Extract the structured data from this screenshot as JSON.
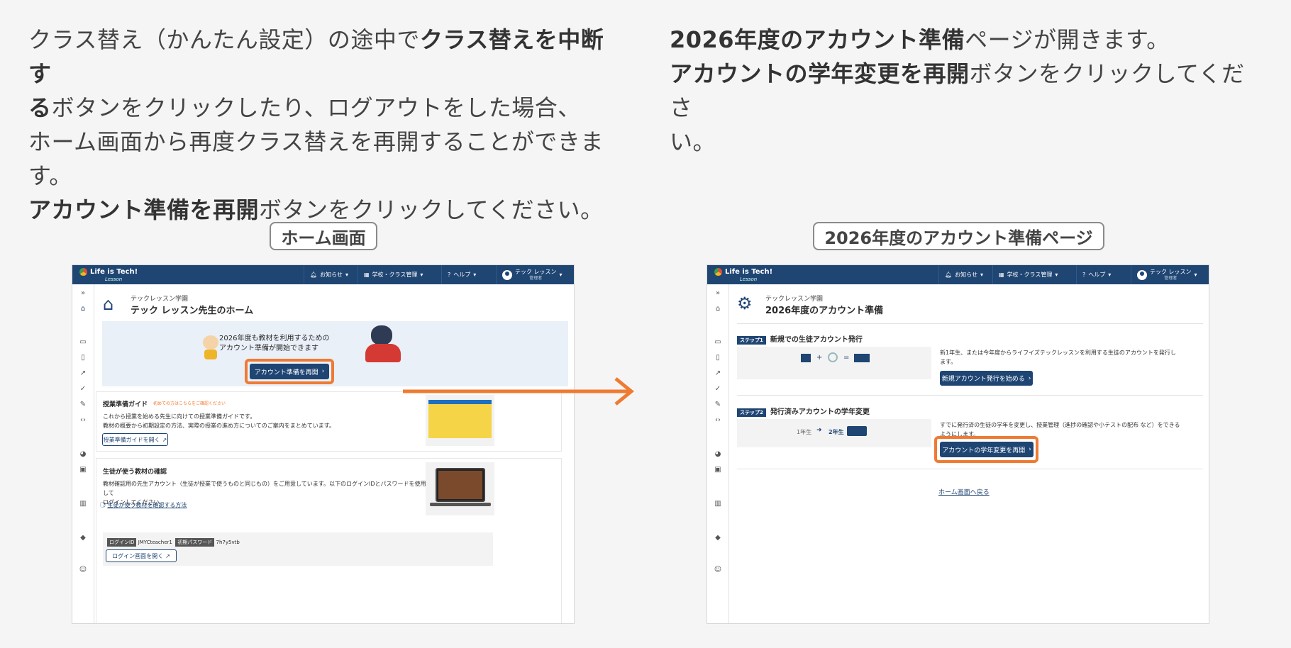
{
  "left_text": {
    "l1_a": "クラス替え（かんたん設定）の途中で",
    "l1_b": "クラス替えを中断す",
    "l2_a": "る",
    "l2_b": "ボタンをクリックしたり、ログアウトをした場合、",
    "l3": "ホーム画面から再度クラス替えを再開することができま",
    "l4": "す。",
    "l5_a": "アカウント準備を再開",
    "l5_b": "ボタンをクリックしてください。"
  },
  "right_text": {
    "l1_a": "2026年度のアカウント準備",
    "l1_b": "ページが開きます。",
    "l2_a": "アカウントの学年変更を再開",
    "l2_b": "ボタンをクリックしてくださ",
    "l3": "い。"
  },
  "captions": {
    "left": "ホーム画面",
    "right": "2026年度のアカウント準備ページ"
  },
  "topbar": {
    "logo": "Life is Tech!",
    "logo_sub": "Lesson",
    "news": "お知らせ",
    "school": "学校・クラス管理",
    "help": "ヘルプ",
    "user": "テック レッスン",
    "role": "管理者"
  },
  "home": {
    "school_name": "テックレッスン学園",
    "title": "テック レッスン先生のホーム",
    "banner_l1": "2026年度も教材を利用するための",
    "banner_l2": "アカウント準備が開始できます",
    "resume_button": "アカウント準備を再開",
    "guide_title": "授業準備ガイド",
    "guide_note": "初めての方はこちらをご確認ください",
    "guide_d1": "これから授業を始める先生に向けての授業準備ガイドです。",
    "guide_d2": "教材の概要から初期設定の方法、実際の授業の進め方についてのご案内をまとめています。",
    "guide_button": "授業準備ガイドを開く",
    "check_title": "生徒が使う教材の確認",
    "check_d1": "教材確認用の先生アカウント（生徒が授業で使うものと同じもの）をご用意しています。以下のログインIDとパスワードを使用して",
    "check_d2": "ログインしてください。",
    "check_link": "生徒が使う教材を確認する方法",
    "login_id_label": "ログインID",
    "login_id": "JMYCteacher1",
    "password_label": "初期パスワード",
    "password": "7h7y5vtb",
    "login_button": "ログイン画面を開く"
  },
  "prep": {
    "school_name": "テックレッスン学園",
    "title": "2026年度のアカウント準備",
    "step1_tag": "ステップ1",
    "step1_title": "新規での生徒アカウント発行",
    "step1_desc1": "新1年生、または今年度からライフイズテックレッスンを利用する生徒のアカウントを発行し",
    "step1_desc2": "ます。",
    "step1_button": "新規アカウント発行を始める",
    "step2_tag": "ステップ2",
    "step2_title": "発行済みアカウントの学年変更",
    "step2_desc1": "すでに発行済の生徒の学年を変更し、授業管理（進捗の確認や小テストの配布 など）をできる",
    "step2_desc2": "ようにします。",
    "step2_button": "アカウントの学年変更を再開",
    "grade_from": "1年生",
    "grade_to": "2年生",
    "back_link": "ホーム画面へ戻る"
  },
  "colors": {
    "navy": "#1f4573",
    "highlight": "#ef7b33"
  }
}
